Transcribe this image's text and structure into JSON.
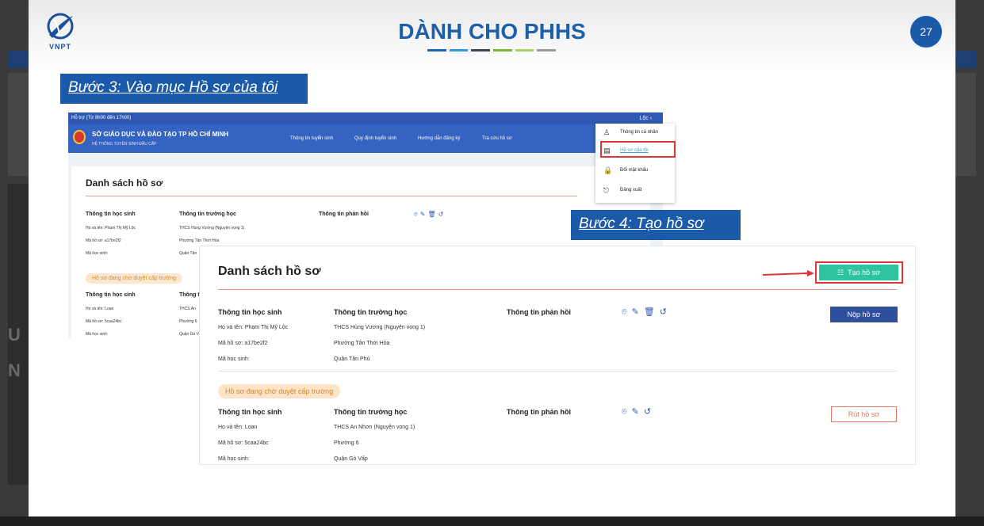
{
  "slide": {
    "title": "DÀNH CHO PHHS",
    "page_number": "27",
    "logo_text": "VNPT",
    "title_bar_colors": [
      "#1e63b5",
      "#2f9be0",
      "#39475b",
      "#7bb63a",
      "#a7d36a",
      "#9b9b9b"
    ]
  },
  "steps": {
    "step3": "Bước 3: Vào mục Hồ sơ của tôi",
    "step4": "Bước 4: Tạo hồ sơ"
  },
  "portal": {
    "topbar_text": "Hỗ trợ (Từ 8h00 đến 17h00)",
    "user_name": "Lộc",
    "org_name": "SỞ GIÁO DỤC VÀ ĐÀO TẠO TP HỒ CHÍ MINH",
    "org_sub": "HỆ THỐNG TUYỂN SINH ĐẦU CẤP",
    "nav": [
      "Thông tin tuyển sinh",
      "Quy định tuyển sinh",
      "Hướng dẫn đăng ký",
      "Tra cứu hồ sơ"
    ],
    "user_menu": [
      {
        "icon": "user-icon",
        "label": "Thông tin cá nhân"
      },
      {
        "icon": "document-icon",
        "label": "Hồ sơ của tôi"
      },
      {
        "icon": "lock-icon",
        "label": "Đổi mật khẩu"
      },
      {
        "icon": "logout-icon",
        "label": "Đăng xuất"
      }
    ]
  },
  "list": {
    "title": "Danh sách hồ sơ",
    "create_label": "Tạo hồ sơ",
    "columns": [
      "Thông tin học sinh",
      "Thông tin trường học",
      "Thông tin phản hồi"
    ],
    "records": [
      {
        "name": "Họ và tên: Phạm Thị Mỹ Lộc",
        "code": "Mã hồ sơ: a17be2f2",
        "student_id": "Mã học sinh:",
        "school": "THCS Hùng Vương (Nguyện vọng 1)",
        "ward": "Phường Tân Thới Hòa",
        "district": "Quận Tân Phú",
        "action": "Nộp hồ sơ"
      },
      {
        "status": "Hồ sơ đang chờ duyệt cấp trường",
        "name": "Họ và tên: Loan",
        "code": "Mã hồ sơ: 5caa24bc",
        "student_id": "Mã học sinh:",
        "school": "THCS An Nhơn (Nguyện vọng 1)",
        "ward": "Phường 6",
        "district": "Quận Gò Vấp",
        "action": "Rút hồ sơ"
      }
    ]
  },
  "shot1_partial": {
    "school_1": "THCS Hùng Vương (Nguyện vọng 1)",
    "ward_1": "Phường Tân Thới Hòa",
    "district_1": "Quận Tân",
    "school_2": "THCS An",
    "ward_2": "Phường 6",
    "district_2": "Quận Gò V"
  },
  "colors": {
    "brand_blue": "#1a5aa8",
    "portal_blue": "#3563c1",
    "create_green": "#2ec4a0",
    "highlight_red": "#e03535"
  }
}
